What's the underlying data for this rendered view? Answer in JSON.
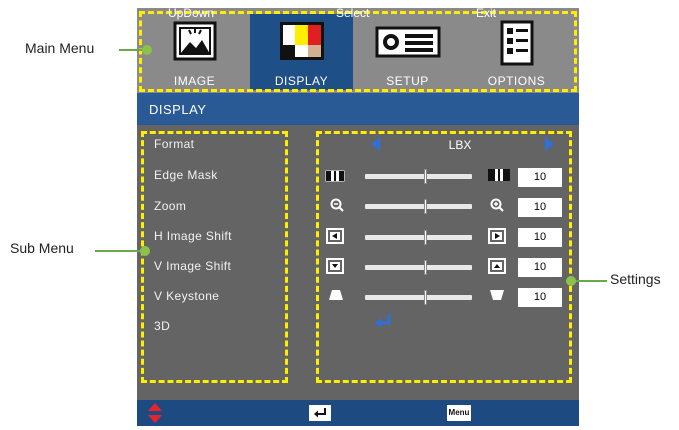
{
  "annotations": {
    "main_menu": "Main Menu",
    "sub_menu": "Sub Menu",
    "settings": "Settings"
  },
  "tabs": [
    {
      "label": "IMAGE",
      "icon": "image-icon"
    },
    {
      "label": "DISPLAY",
      "icon": "display-icon"
    },
    {
      "label": "SETUP",
      "icon": "projector-icon"
    },
    {
      "label": "OPTIONS",
      "icon": "document-icon"
    }
  ],
  "active_tab": "DISPLAY",
  "header": {
    "title": "DISPLAY"
  },
  "submenu": [
    {
      "label": "Format"
    },
    {
      "label": "Edge Mask"
    },
    {
      "label": "Zoom"
    },
    {
      "label": "H Image Shift"
    },
    {
      "label": "V Image Shift"
    },
    {
      "label": "V Keystone"
    },
    {
      "label": "3D"
    }
  ],
  "settings": {
    "format_value": "LBX",
    "edge_mask_value": "10",
    "zoom_value": "10",
    "h_image_shift_value": "10",
    "v_image_shift_value": "10",
    "v_keystone_value": "10"
  },
  "footer": {
    "updown": "UpDown",
    "select": "Select",
    "menu_key": "Menu",
    "exit": "Exit"
  },
  "colors": {
    "accent_yellow": "#ffee00",
    "header_blue": "#2a5a96",
    "footer_blue": "#1d4a80",
    "arrow_blue": "#2f6fd9",
    "annotation_green": "#8bc34a"
  }
}
